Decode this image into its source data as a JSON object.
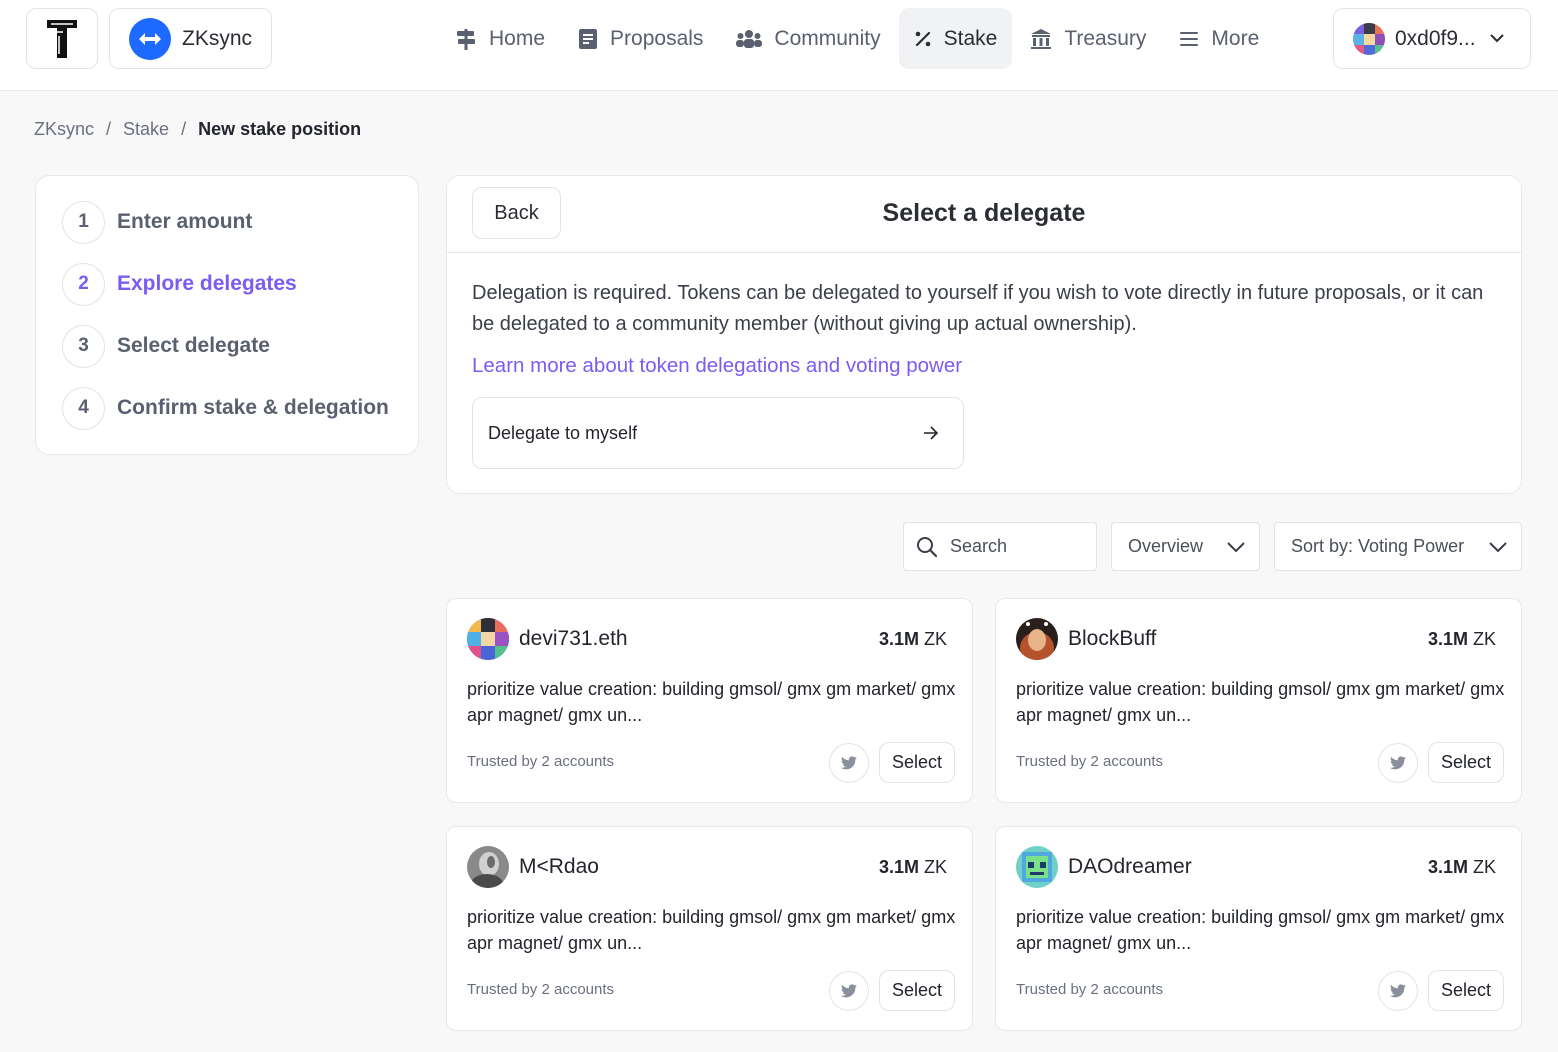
{
  "header": {
    "dao_name": "ZKsync",
    "nav": [
      {
        "label": "Home",
        "icon": "signpost-icon"
      },
      {
        "label": "Proposals",
        "icon": "document-icon"
      },
      {
        "label": "Community",
        "icon": "people-icon"
      },
      {
        "label": "Stake",
        "icon": "percent-icon",
        "active": true
      },
      {
        "label": "Treasury",
        "icon": "bank-icon"
      },
      {
        "label": "More",
        "icon": "menu-icon"
      }
    ],
    "wallet_address": "0xd0f9..."
  },
  "breadcrumb": {
    "items": [
      "ZKsync",
      "Stake"
    ],
    "current": "New stake position",
    "separator": "/"
  },
  "steps": [
    {
      "number": "1",
      "label": "Enter amount"
    },
    {
      "number": "2",
      "label": "Explore delegates",
      "active": true
    },
    {
      "number": "3",
      "label": "Select delegate"
    },
    {
      "number": "4",
      "label": "Confirm stake & delegation"
    }
  ],
  "main": {
    "back_label": "Back",
    "title": "Select a delegate",
    "description": "Delegation is required. Tokens can be delegated to yourself if you wish to vote directly in future proposals, or it can be delegated to a community member (without giving up actual ownership).",
    "learn_more": "Learn more about token delegations and voting power",
    "delegate_self": "Delegate to myself"
  },
  "filters": {
    "search_placeholder": "Search",
    "view": "Overview",
    "sort": "Sort by: Voting Power"
  },
  "delegates": [
    {
      "name": "devi731.eth",
      "power": "3.1M",
      "unit": "ZK",
      "statement": "prioritize value creation: building gmsol/ gmx gm market/ gmx apr magnet/ gmx un...",
      "trusted": "Trusted by 2 accounts",
      "select": "Select"
    },
    {
      "name": "BlockBuff",
      "power": "3.1M",
      "unit": "ZK",
      "statement": "prioritize value creation: building gmsol/ gmx gm market/ gmx apr magnet/ gmx un...",
      "trusted": "Trusted by 2 accounts",
      "select": "Select"
    },
    {
      "name": "M<Rdao",
      "power": "3.1M",
      "unit": "ZK",
      "statement": "prioritize value creation: building gmsol/ gmx gm market/ gmx apr magnet/ gmx un...",
      "trusted": "Trusted by 2 accounts",
      "select": "Select"
    },
    {
      "name": "DAOdreamer",
      "power": "3.1M",
      "unit": "ZK",
      "statement": "prioritize value creation: building gmsol/ gmx gm market/ gmx apr magnet/ gmx un...",
      "trusted": "Trusted by 2 accounts",
      "select": "Select"
    }
  ],
  "colors": {
    "accent": "#7b5cf0",
    "zksync_blue": "#1e69ff",
    "text": "#2a2d34",
    "muted": "#6b7080",
    "border": "#e2e3e6"
  }
}
